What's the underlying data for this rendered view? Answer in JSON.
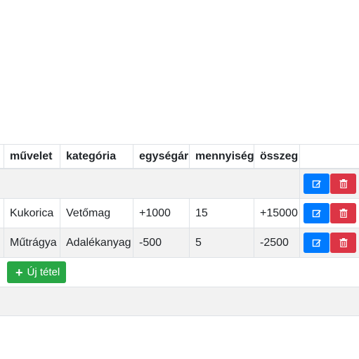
{
  "table": {
    "headers": [
      "",
      "művelet",
      "kategória",
      "egységár",
      "mennyiség",
      "összeg",
      ""
    ],
    "rows": [
      {
        "muvelet": "",
        "kategoria": "",
        "egysegar": "",
        "mennyiseg": "",
        "osszeg": ""
      },
      {
        "muvelet": "Kukorica",
        "kategoria": "Vetőmag",
        "egysegar": "+1000",
        "mennyiseg": "15",
        "osszeg": "+15000"
      },
      {
        "muvelet": "Műtrágya",
        "kategoria": "Adalékanyag",
        "egysegar": "-500",
        "mennyiseg": "5",
        "osszeg": "-2500"
      }
    ],
    "actions": {
      "edit_icon": "edit-icon",
      "delete_icon": "trash-icon"
    }
  },
  "new_item_button": {
    "label": "Új tétel",
    "icon": "plus-icon"
  },
  "colors": {
    "edit": "#007bff",
    "delete": "#dc3545",
    "new": "#28a745",
    "stripe": "#f2f2f2"
  }
}
